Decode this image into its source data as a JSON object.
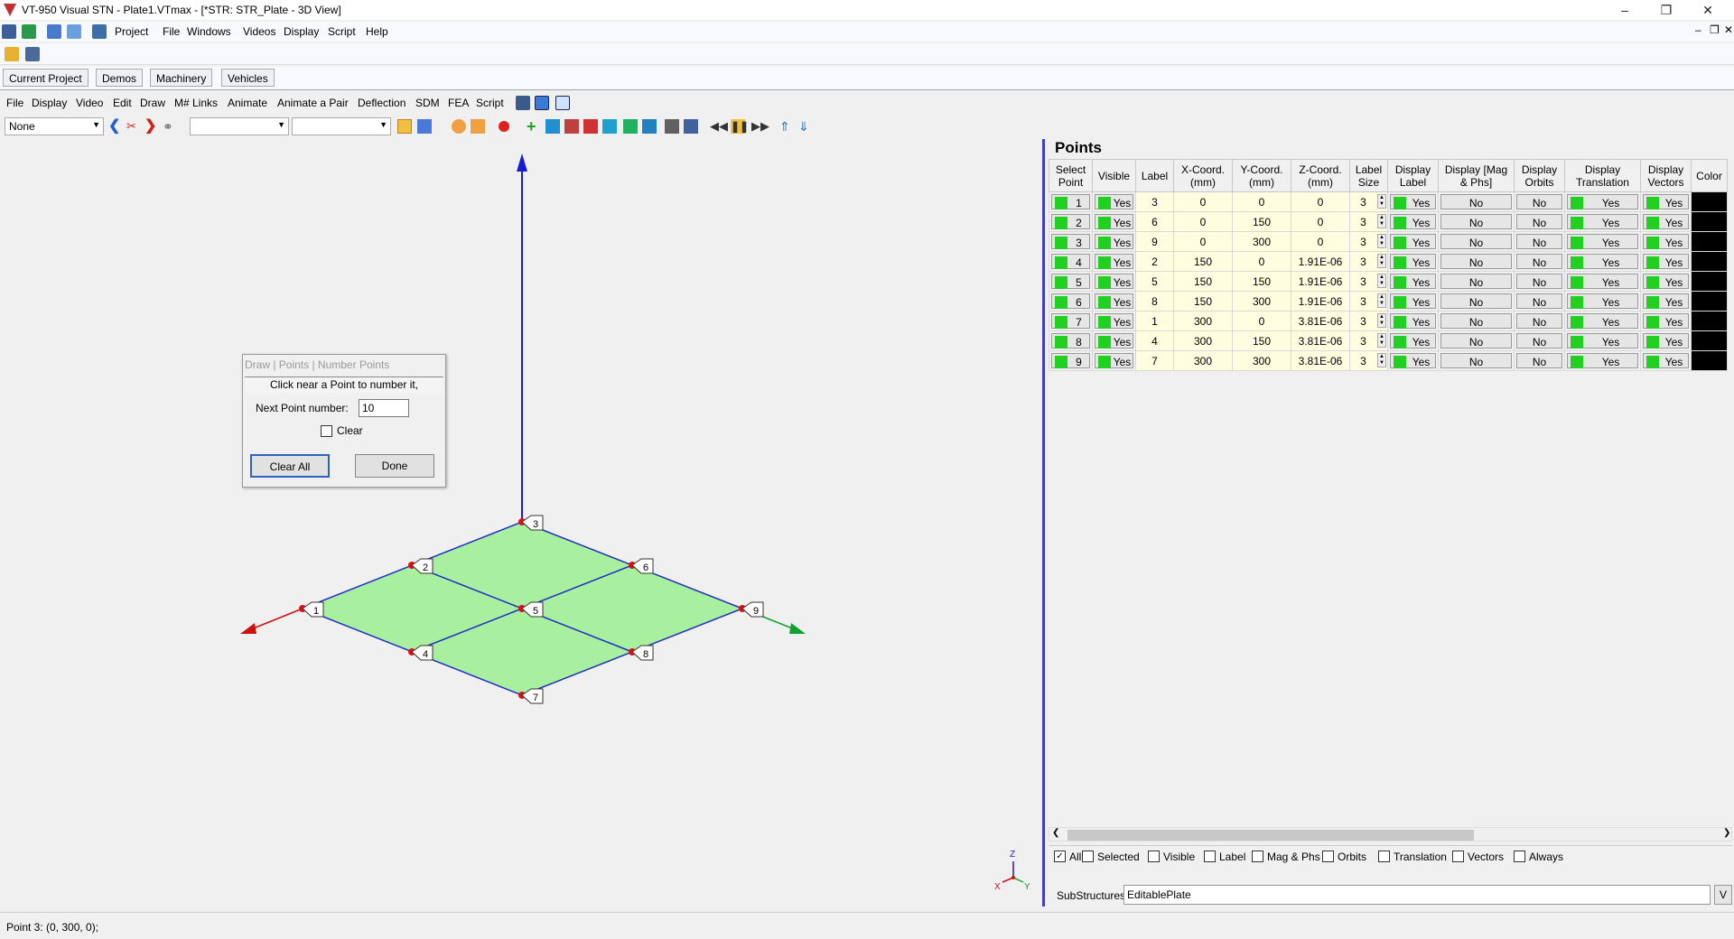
{
  "window": {
    "title": "VT-950 Visual STN - Plate1.VTmax - [*STR: STR_Plate - 3D View]",
    "minimize": "–",
    "maximize": "❐",
    "close": "✕",
    "child_minimize": "–",
    "child_restore": "❐",
    "child_close": "✕"
  },
  "main_menu": [
    "Project",
    "File",
    "Windows",
    "Videos",
    "Display",
    "Script",
    "Help"
  ],
  "project_tabs": [
    "Current Project",
    "Demos",
    "Machinery",
    "Vehicles"
  ],
  "window_menu": [
    "File",
    "Display",
    "Video",
    "Edit",
    "Draw",
    "M# Links",
    "Animate",
    "Animate a Pair",
    "Deflection",
    "SDM",
    "FEA",
    "Script"
  ],
  "toolbar": {
    "selection_dropdown": "None",
    "dropdown2": "",
    "dropdown3": ""
  },
  "dialog": {
    "title": "Draw | Points | Number Points",
    "message": "Click near a Point to number it,",
    "next_label": "Next Point number:",
    "next_value": "10",
    "clear_label": "Clear",
    "clear_all_label": "Clear All",
    "done_label": "Done"
  },
  "view_labels": [
    "1",
    "2",
    "3",
    "4",
    "5",
    "6",
    "7",
    "8",
    "9"
  ],
  "triad": {
    "x": "X",
    "y": "Y",
    "z": "Z"
  },
  "colors": {
    "plate": "#a8f0a0",
    "edge": "#2030c0",
    "point": "#e01010",
    "z_axis": "#1a1ad0",
    "x_axis": "#d01010",
    "y_axis": "#10a030",
    "panel_divider": "#4040c0"
  },
  "points": {
    "title": "Points",
    "columns": [
      "Select Point",
      "Visible",
      "Label",
      "X-Coord. (mm)",
      "Y-Coord. (mm)",
      "Z-Coord. (mm)",
      "Label Size",
      "Display Label",
      "Display [Mag & Phs]",
      "Display Orbits",
      "Display Translation",
      "Display Vectors",
      "Color"
    ],
    "rows": [
      {
        "num": "1",
        "visible": "Yes",
        "label": "3",
        "x": "0",
        "y": "0",
        "z": "0",
        "size": "3",
        "disp_label": "Yes",
        "mag": "No",
        "orbits": "No",
        "trans": "Yes",
        "vectors": "Yes"
      },
      {
        "num": "2",
        "visible": "Yes",
        "label": "6",
        "x": "0",
        "y": "150",
        "z": "0",
        "size": "3",
        "disp_label": "Yes",
        "mag": "No",
        "orbits": "No",
        "trans": "Yes",
        "vectors": "Yes"
      },
      {
        "num": "3",
        "visible": "Yes",
        "label": "9",
        "x": "0",
        "y": "300",
        "z": "0",
        "size": "3",
        "disp_label": "Yes",
        "mag": "No",
        "orbits": "No",
        "trans": "Yes",
        "vectors": "Yes"
      },
      {
        "num": "4",
        "visible": "Yes",
        "label": "2",
        "x": "150",
        "y": "0",
        "z": "1.91E-06",
        "size": "3",
        "disp_label": "Yes",
        "mag": "No",
        "orbits": "No",
        "trans": "Yes",
        "vectors": "Yes"
      },
      {
        "num": "5",
        "visible": "Yes",
        "label": "5",
        "x": "150",
        "y": "150",
        "z": "1.91E-06",
        "size": "3",
        "disp_label": "Yes",
        "mag": "No",
        "orbits": "No",
        "trans": "Yes",
        "vectors": "Yes"
      },
      {
        "num": "6",
        "visible": "Yes",
        "label": "8",
        "x": "150",
        "y": "300",
        "z": "1.91E-06",
        "size": "3",
        "disp_label": "Yes",
        "mag": "No",
        "orbits": "No",
        "trans": "Yes",
        "vectors": "Yes"
      },
      {
        "num": "7",
        "visible": "Yes",
        "label": "1",
        "x": "300",
        "y": "0",
        "z": "3.81E-06",
        "size": "3",
        "disp_label": "Yes",
        "mag": "No",
        "orbits": "No",
        "trans": "Yes",
        "vectors": "Yes"
      },
      {
        "num": "8",
        "visible": "Yes",
        "label": "4",
        "x": "300",
        "y": "150",
        "z": "3.81E-06",
        "size": "3",
        "disp_label": "Yes",
        "mag": "No",
        "orbits": "No",
        "trans": "Yes",
        "vectors": "Yes"
      },
      {
        "num": "9",
        "visible": "Yes",
        "label": "7",
        "x": "300",
        "y": "300",
        "z": "3.81E-06",
        "size": "3",
        "disp_label": "Yes",
        "mag": "No",
        "orbits": "No",
        "trans": "Yes",
        "vectors": "Yes"
      }
    ]
  },
  "filters": [
    "All",
    "Selected",
    "Visible",
    "Label",
    "Mag & Phs",
    "Orbits",
    "Translation",
    "Vectors",
    "Always"
  ],
  "substructures": {
    "label": "SubStructures",
    "value": "EditablePlate",
    "button": "V"
  },
  "status": "Point 3: (0, 300, 0);"
}
